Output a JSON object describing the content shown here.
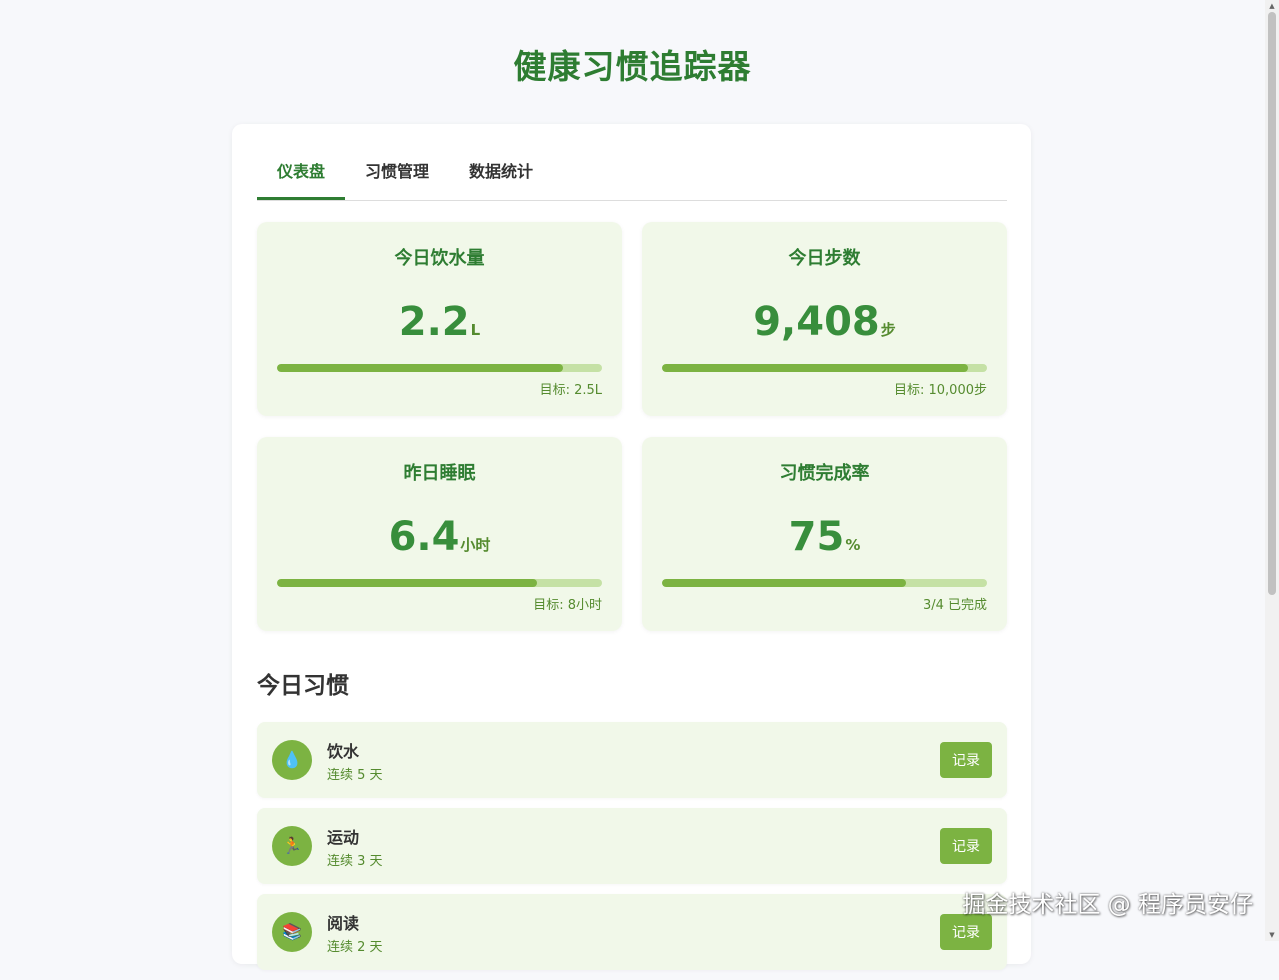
{
  "header": {
    "title": "健康习惯追踪器"
  },
  "tabs": [
    {
      "label": "仪表盘",
      "active": true
    },
    {
      "label": "习惯管理",
      "active": false
    },
    {
      "label": "数据统计",
      "active": false
    }
  ],
  "stats": [
    {
      "title": "今日饮水量",
      "value": "2.2",
      "unit": "L",
      "progress": 0.88,
      "goal": "目标: 2.5L"
    },
    {
      "title": "今日步数",
      "value": "9,408",
      "unit": "步",
      "progress": 0.94,
      "goal": "目标: 10,000步"
    },
    {
      "title": "昨日睡眠",
      "value": "6.4",
      "unit": "小时",
      "progress": 0.8,
      "goal": "目标: 8小时"
    },
    {
      "title": "习惯完成率",
      "value": "75",
      "unit": "%",
      "progress": 0.75,
      "goal": "3/4 已完成"
    }
  ],
  "today": {
    "title": "今日习惯",
    "habits": [
      {
        "icon": "💧",
        "icon_name": "water-drop-icon",
        "name": "饮水",
        "streak": "连续 5 天",
        "button": "记录"
      },
      {
        "icon": "🏃",
        "icon_name": "running-icon",
        "name": "运动",
        "streak": "连续 3 天",
        "button": "记录"
      },
      {
        "icon": "📚",
        "icon_name": "books-icon",
        "name": "阅读",
        "streak": "连续 2 天",
        "button": "记录"
      }
    ]
  },
  "watermark": "掘金技术社区 @ 程序员安仔",
  "colors": {
    "primary": "#2e7d32",
    "accent": "#7cb342",
    "card_bg": "#f1f8e9",
    "track": "#c5e1a5"
  }
}
